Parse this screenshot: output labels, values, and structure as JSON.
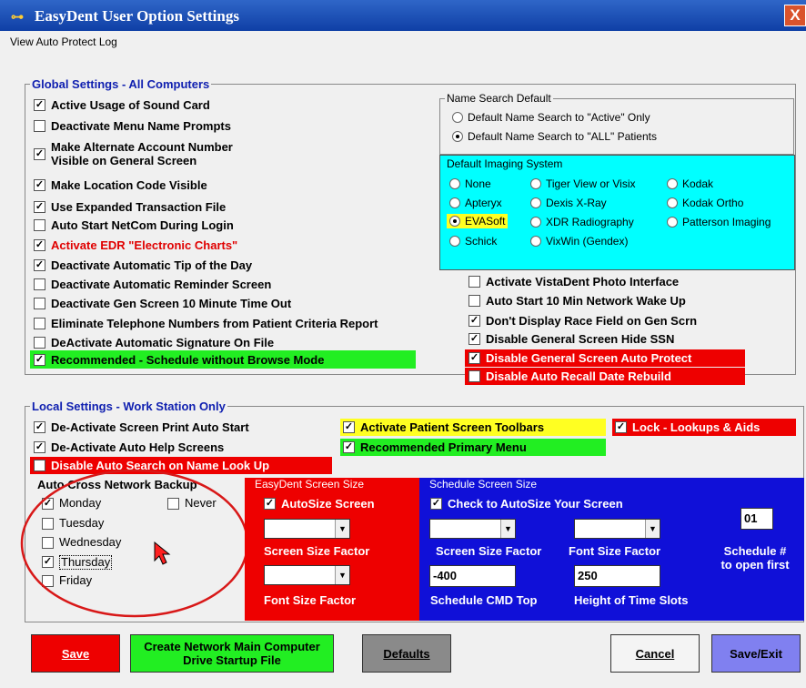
{
  "window": {
    "title": "EasyDent User Option Settings",
    "close_label": "X"
  },
  "menu": {
    "view_log": "View Auto Protect Log"
  },
  "global": {
    "legend": "Global Settings - All Computers",
    "items": [
      {
        "label": "Active Usage of Sound Card",
        "checked": true
      },
      {
        "label": "Deactivate Menu Name Prompts",
        "checked": false
      },
      {
        "label": "Make Alternate Account Number",
        "label2": "Visible on General Screen",
        "checked": true
      },
      {
        "label": "Make Location Code Visible",
        "checked": true
      },
      {
        "label": "Use Expanded Transaction File",
        "checked": true
      },
      {
        "label": "Auto Start NetCom During Login",
        "checked": false
      },
      {
        "label": "Activate EDR \"Electronic Charts\"",
        "checked": true
      },
      {
        "label": "Deactivate Automatic Tip of the Day",
        "checked": true
      },
      {
        "label": "Deactivate Automatic Reminder Screen",
        "checked": false
      },
      {
        "label": "Deactivate Gen Screen 10 Minute Time Out",
        "checked": false
      },
      {
        "label": "Eliminate Telephone Numbers from Patient Criteria Report",
        "checked": false
      },
      {
        "label": "DeActivate Automatic Signature On File",
        "checked": false
      },
      {
        "label": "Recommended - Schedule without Browse Mode",
        "checked": true
      }
    ],
    "right_items": [
      {
        "label": "Activate VistaDent Photo Interface",
        "checked": false
      },
      {
        "label": "Auto Start 10 Min Network Wake Up",
        "checked": false
      },
      {
        "label": "Don't Display Race Field on Gen Scrn",
        "checked": true
      },
      {
        "label": "Disable General Screen Hide SSN",
        "checked": true
      },
      {
        "label": "Disable General Screen Auto Protect",
        "checked": true
      },
      {
        "label": "Disable Auto Recall Date Rebuild",
        "checked": false
      }
    ]
  },
  "name_search": {
    "legend": "Name Search Default",
    "options": [
      "Default Name Search to \"Active\" Only",
      "Default Name Search to \"ALL\" Patients"
    ],
    "selected": "Default Name Search to \"ALL\" Patients"
  },
  "imaging": {
    "legend": "Default Imaging System",
    "options": [
      "None",
      "Tiger View or Visix",
      "Kodak",
      "Apteryx",
      "Dexis X-Ray",
      "Kodak Ortho",
      "EVASoft",
      "XDR Radiography",
      "Patterson Imaging",
      "Schick",
      "VixWin (Gendex)"
    ],
    "selected": "EVASoft"
  },
  "local": {
    "legend": "Local Settings - Work Station Only",
    "screen_print": "De-Activate Screen Print Auto Start",
    "auto_help": "De-Activate Auto Help Screens",
    "disable_auto_search": "Disable Auto Search on Name Look Up",
    "patient_toolbars": "Activate Patient Screen Toolbars",
    "primary_menu": "Recommended Primary Menu",
    "lock_lookups": "Lock - Lookups & Aids"
  },
  "backup": {
    "legend": "Auto Cross Network Backup",
    "days": [
      {
        "label": "Monday",
        "checked": true
      },
      {
        "label": "Tuesday",
        "checked": false
      },
      {
        "label": "Wednesday",
        "checked": false
      },
      {
        "label": "Thursday",
        "checked": true
      },
      {
        "label": "Friday",
        "checked": false
      }
    ],
    "never": "Never"
  },
  "easydent_size": {
    "title": "EasyDent Screen Size",
    "autosize": "AutoSize Screen",
    "screen_factor": "Screen Size Factor",
    "font_factor": "Font Size Factor"
  },
  "schedule_size": {
    "title": "Schedule Screen Size",
    "autosize": "Check to AutoSize Your Screen",
    "screen_factor": "Screen Size Factor",
    "font_factor": "Font Size Factor",
    "schedule_label": "Schedule # to open first",
    "schedule_value": "01",
    "cmd_top_value": "-400",
    "cmd_top_label": "Schedule CMD Top",
    "slot_value": "250",
    "slot_label": "Height of Time Slots"
  },
  "buttons": {
    "save": "Save",
    "create_startup": "Create Network Main Computer Drive Startup File",
    "defaults": "Defaults",
    "cancel": "Cancel",
    "save_exit": "Save/Exit"
  },
  "colors": {
    "blue_panel": "#1010d8",
    "red_panel": "#ee0000",
    "imaging_bg": "#00ffff",
    "highlight_green": "#22ee22",
    "highlight_yellow": "#ffff22",
    "highlight_red": "#ee0000"
  }
}
